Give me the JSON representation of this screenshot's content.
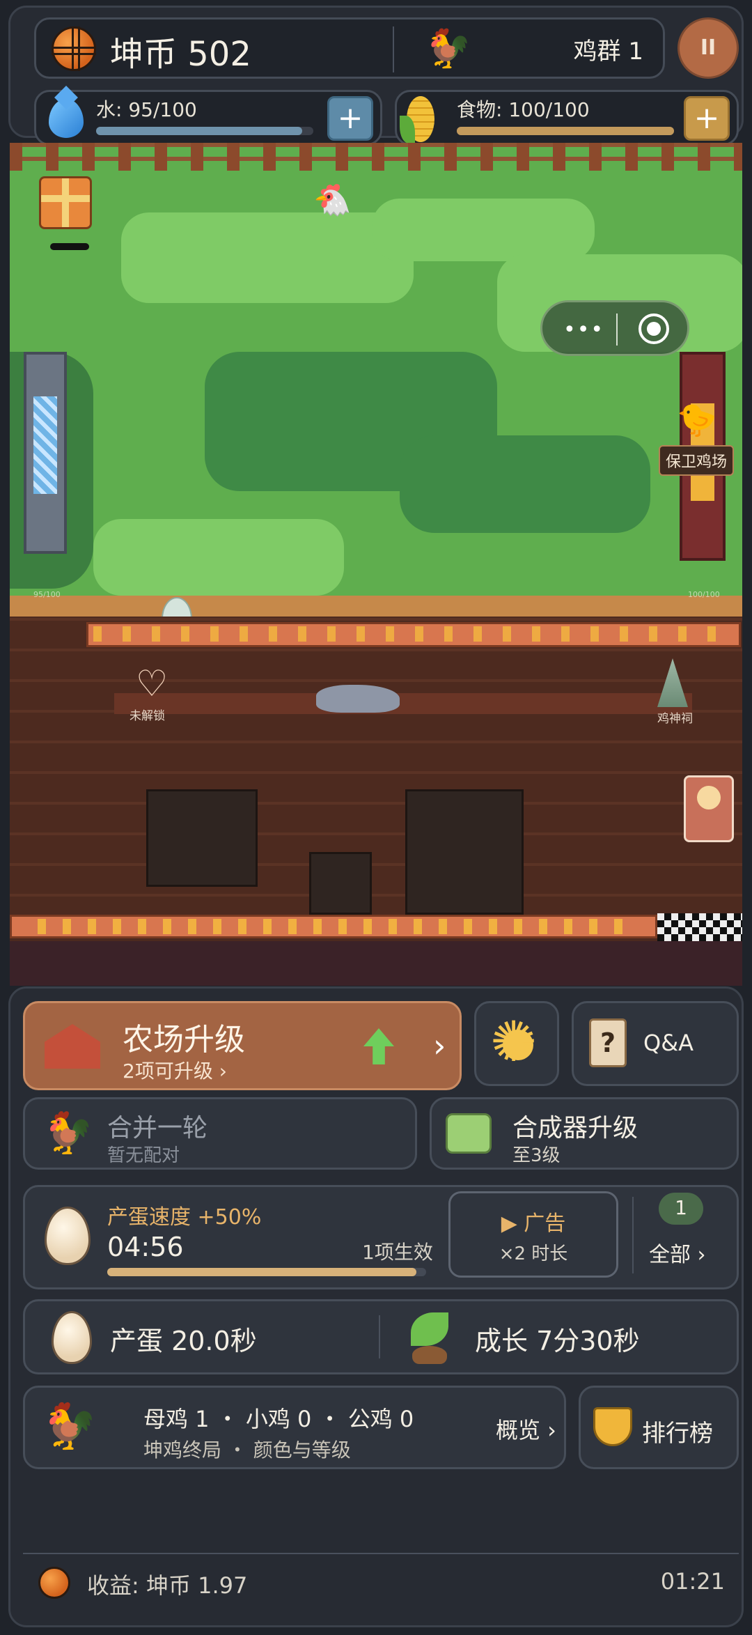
{
  "hud": {
    "coins_label": "坤币 502",
    "flock_label": "鸡群 1",
    "pause_symbol": "II",
    "water_label": "水: 95/100",
    "water_level": 0.95,
    "food_label": "食物: 100/100",
    "food_level": 1.0,
    "plus_symbol": "+"
  },
  "scene": {
    "defend_label": "保卫鸡场",
    "locked_label": "未解锁",
    "shrine_label": "鸡神祠",
    "water_tower_reading": "95/100",
    "food_tower_reading": "100/100",
    "miniprogram_more": "•••"
  },
  "panel": {
    "upgrade": {
      "title": "农场升级",
      "sub": "2项可升级 ›",
      "chev": "›"
    },
    "qa_label": "Q&A",
    "qa_icon": "?",
    "merge": {
      "title": "合并一轮",
      "sub": "暂无配对"
    },
    "synth": {
      "title": "合成器升级",
      "sub": "至3级"
    },
    "boost": {
      "title": "产蛋速度 +50%",
      "time": "04:56",
      "effects": "1项生效",
      "progress": 0.97,
      "ad_title": "▶ 广告",
      "ad_sub": "×2 时长",
      "count": "1",
      "all_label": "全部 ›"
    },
    "stats": {
      "lay": "产蛋  20.0秒",
      "grow": "成长  7分30秒"
    },
    "flock": {
      "line1": "母鸡 1 ・ 小鸡 0 ・ 公鸡 0",
      "line2": "坤鸡终局 ・ 颜色与等级",
      "overview": "概览 ›"
    },
    "rank_label": "排行榜",
    "footer": {
      "income": "收益: 坤币 1.97",
      "time": "01:21"
    }
  }
}
